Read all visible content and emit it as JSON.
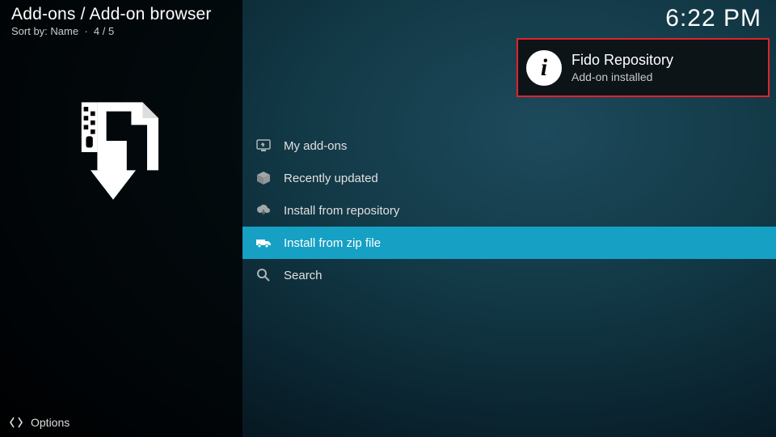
{
  "header": {
    "title": "Add-ons / Add-on browser",
    "sort_label": "Sort by: Name",
    "position": "4 / 5"
  },
  "clock": "6:22 PM",
  "menu": {
    "items": [
      {
        "label": "My add-ons",
        "icon": "monitor-icon",
        "selected": false
      },
      {
        "label": "Recently updated",
        "icon": "box-icon",
        "selected": false
      },
      {
        "label": "Install from repository",
        "icon": "cloud-download-icon",
        "selected": false
      },
      {
        "label": "Install from zip file",
        "icon": "truck-icon",
        "selected": true
      },
      {
        "label": "Search",
        "icon": "search-icon",
        "selected": false
      }
    ]
  },
  "notification": {
    "title": "Fido Repository",
    "subtitle": "Add-on installed",
    "icon": "info-icon"
  },
  "options": {
    "label": "Options"
  },
  "colors": {
    "accent": "#16a0c4",
    "highlight_border": "#e2222a"
  }
}
